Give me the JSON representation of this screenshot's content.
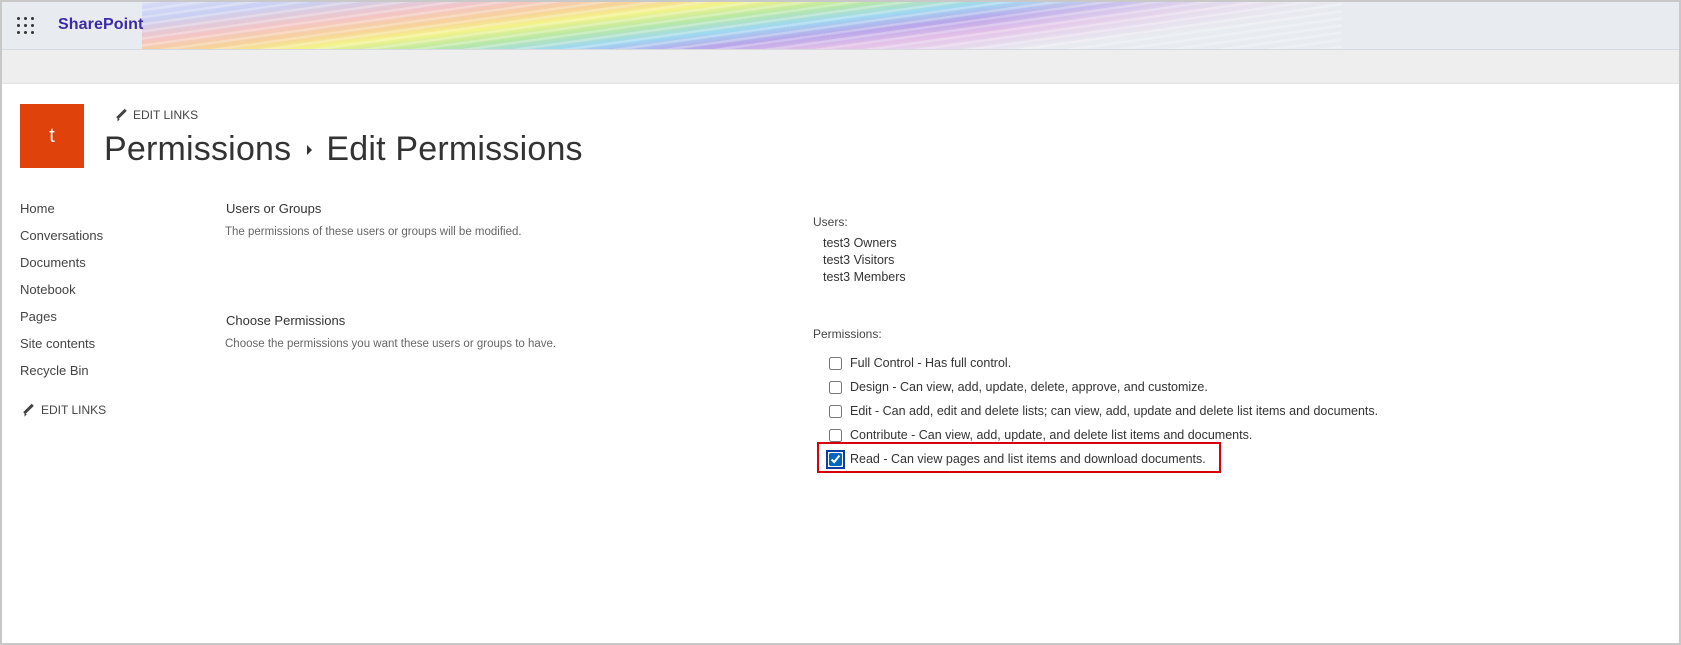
{
  "suitebar": {
    "brand": "SharePoint",
    "waffle_icon": "app-launcher-icon"
  },
  "header": {
    "site_logo_letter": "t",
    "edit_links": "EDIT LINKS",
    "breadcrumb_parent": "Permissions",
    "breadcrumb_current": "Edit Permissions",
    "logo_color": "#e0420c"
  },
  "leftnav": {
    "items": [
      "Home",
      "Conversations",
      "Documents",
      "Notebook",
      "Pages",
      "Site contents",
      "Recycle Bin"
    ],
    "edit_links": "EDIT LINKS"
  },
  "form": {
    "users_section": {
      "title": "Users or Groups",
      "description": "The permissions of these users or groups will be modified."
    },
    "permissions_section": {
      "title": "Choose Permissions",
      "description": "Choose the permissions you want these users or groups to have."
    },
    "users_label": "Users:",
    "users": [
      "test3 Owners",
      "test3 Visitors",
      "test3 Members"
    ],
    "permissions_label": "Permissions:",
    "permissions": [
      {
        "label": "Full Control - Has full control.",
        "checked": false
      },
      {
        "label": "Design - Can view, add, update, delete, approve, and customize.",
        "checked": false
      },
      {
        "label": "Edit - Can add, edit and delete lists; can view, add, update and delete list items and documents.",
        "checked": false
      },
      {
        "label": "Contribute - Can view, add, update, and delete list items and documents.",
        "checked": false
      },
      {
        "label": "Read - Can view pages and list items and download documents.",
        "checked": true
      }
    ]
  },
  "colors": {
    "brand_text": "#3a2ca8",
    "highlight": "#d8000c"
  }
}
